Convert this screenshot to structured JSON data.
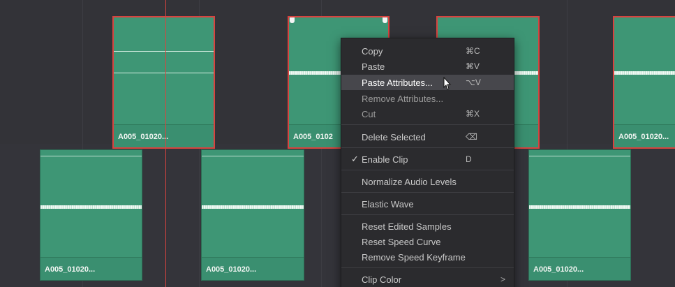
{
  "clips": {
    "upper_left": "A005_01020...",
    "upper_mid": "A005_0102",
    "upper_right": "A005_01020...",
    "lower_1": "A005_01020...",
    "lower_2": "A005_01020...",
    "lower_3": "A005_01020..."
  },
  "context_menu": {
    "copy": "Copy",
    "copy_sc": "⌘C",
    "paste": "Paste",
    "paste_sc": "⌘V",
    "paste_attributes": "Paste Attributes...",
    "paste_attributes_sc": "⌥V",
    "remove_attributes": "Remove Attributes...",
    "cut": "Cut",
    "cut_sc": "⌘X",
    "delete_selected": "Delete Selected",
    "delete_selected_sc": "⌫",
    "enable_clip_check": "✓",
    "enable_clip": "Enable Clip",
    "enable_clip_sc": "D",
    "normalize_audio_levels": "Normalize Audio Levels",
    "elastic_wave": "Elastic Wave",
    "reset_edited_samples": "Reset Edited Samples",
    "reset_speed_curve": "Reset Speed Curve",
    "remove_speed_keyframe": "Remove Speed Keyframe",
    "clip_color": "Clip Color",
    "clip_color_arrow": ">"
  },
  "colors": {
    "clip_green": "#3e9675",
    "selection_red": "#d8433f",
    "menu_bg": "#2b2b2e",
    "menu_highlight": "#47474c"
  },
  "icons": {
    "cursor": "pointer-cursor-icon",
    "submenu": "chevron-right-icon",
    "check": "checkmark-icon"
  }
}
